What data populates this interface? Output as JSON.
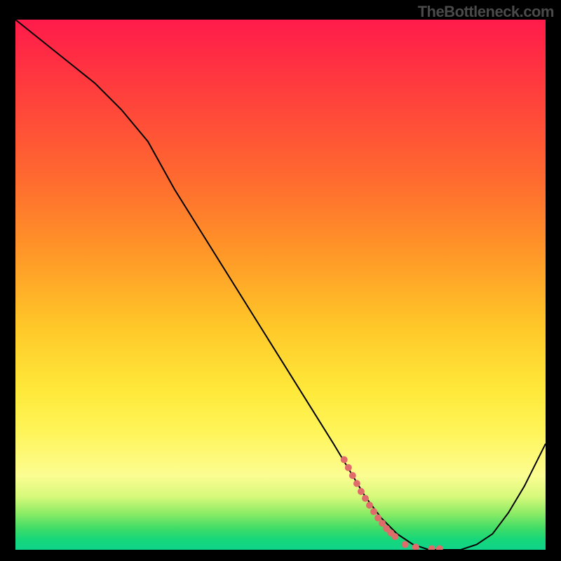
{
  "watermark": "TheBottleneck.com",
  "chart_data": {
    "type": "line",
    "title": "",
    "xlabel": "",
    "ylabel": "",
    "xlim": [
      0,
      100
    ],
    "ylim": [
      0,
      100
    ],
    "grid": false,
    "legend": false,
    "background_gradient": {
      "orientation": "vertical",
      "stops": [
        {
          "pos": 0,
          "color": "#ff1b4b"
        },
        {
          "pos": 12,
          "color": "#ff3a3e"
        },
        {
          "pos": 30,
          "color": "#ff6a2f"
        },
        {
          "pos": 45,
          "color": "#ff9a27"
        },
        {
          "pos": 58,
          "color": "#ffc829"
        },
        {
          "pos": 70,
          "color": "#ffe93a"
        },
        {
          "pos": 78,
          "color": "#fff55a"
        },
        {
          "pos": 86,
          "color": "#fcfd92"
        },
        {
          "pos": 90,
          "color": "#d6f97a"
        },
        {
          "pos": 93,
          "color": "#8fec66"
        },
        {
          "pos": 96,
          "color": "#3fdc67"
        },
        {
          "pos": 98,
          "color": "#17d77a"
        },
        {
          "pos": 100,
          "color": "#0fd389"
        }
      ]
    },
    "series": [
      {
        "name": "curve",
        "color": "#000000",
        "stroke_width": 2,
        "x": [
          0,
          5,
          10,
          15,
          20,
          25,
          30,
          35,
          40,
          45,
          50,
          55,
          60,
          63,
          66,
          69,
          72,
          75,
          78,
          81,
          84,
          87,
          90,
          93,
          96,
          100
        ],
        "y": [
          100,
          96,
          92,
          88,
          83,
          77,
          68,
          60,
          52,
          44,
          36,
          28,
          20,
          15,
          10,
          6,
          3,
          1,
          0,
          0,
          0,
          1,
          3,
          7,
          12,
          20
        ]
      }
    ],
    "markers": {
      "name": "highlight-dots",
      "color": "#e06b6b",
      "radius": 5,
      "points": [
        {
          "x": 62.0,
          "y": 17.0
        },
        {
          "x": 62.8,
          "y": 15.5
        },
        {
          "x": 63.6,
          "y": 14.0
        },
        {
          "x": 64.4,
          "y": 12.5
        },
        {
          "x": 65.2,
          "y": 11.0
        },
        {
          "x": 66.0,
          "y": 9.7
        },
        {
          "x": 66.8,
          "y": 8.4
        },
        {
          "x": 67.6,
          "y": 7.2
        },
        {
          "x": 68.4,
          "y": 6.0
        },
        {
          "x": 69.2,
          "y": 5.0
        },
        {
          "x": 70.0,
          "y": 4.0
        },
        {
          "x": 70.8,
          "y": 3.2
        },
        {
          "x": 71.6,
          "y": 2.5
        },
        {
          "x": 73.5,
          "y": 1.0
        },
        {
          "x": 75.5,
          "y": 0.5
        },
        {
          "x": 78.5,
          "y": 0.2
        },
        {
          "x": 80.0,
          "y": 0.2
        }
      ]
    }
  }
}
